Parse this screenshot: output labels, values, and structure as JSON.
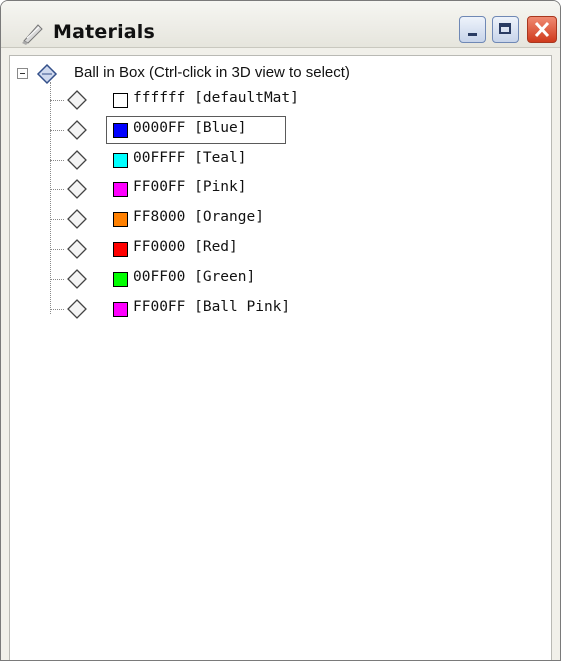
{
  "window": {
    "title": "Materials"
  },
  "tree": {
    "root_label": "Ball in Box (Ctrl-click in 3D view to select)",
    "items": [
      {
        "color": "#ffffff",
        "label": "ffffff [defaultMat]"
      },
      {
        "color": "#0000FF",
        "label": "0000FF [Blue]",
        "selected": true
      },
      {
        "color": "#00FFFF",
        "label": "00FFFF [Teal]"
      },
      {
        "color": "#FF00FF",
        "label": "FF00FF [Pink]"
      },
      {
        "color": "#FF8000",
        "label": "FF8000 [Orange]"
      },
      {
        "color": "#FF0000",
        "label": "FF0000 [Red]"
      },
      {
        "color": "#00FF00",
        "label": "00FF00 [Green]"
      },
      {
        "color": "#FF00FF",
        "label": "FF00FF [Ball Pink]"
      }
    ]
  }
}
